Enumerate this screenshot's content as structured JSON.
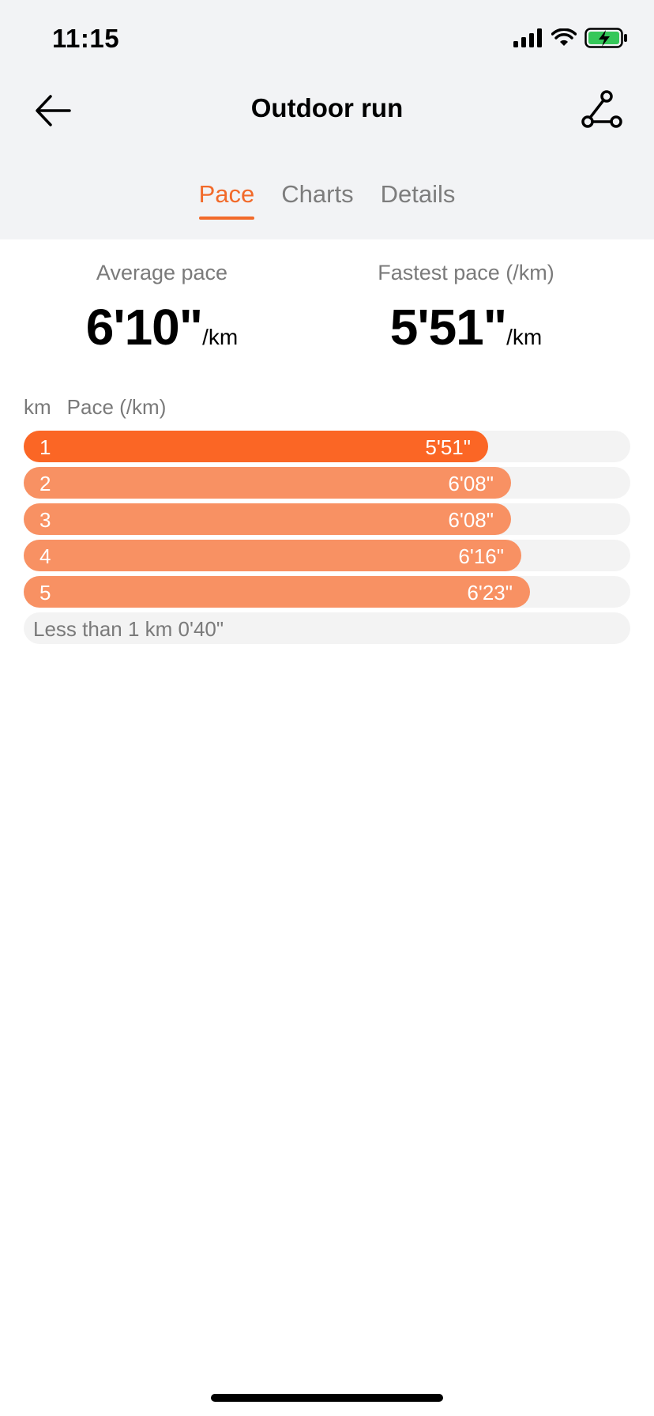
{
  "status_bar": {
    "time": "11:15"
  },
  "header": {
    "title": "Outdoor run"
  },
  "tabs": [
    {
      "label": "Pace",
      "active": true
    },
    {
      "label": "Charts",
      "active": false
    },
    {
      "label": "Details",
      "active": false
    }
  ],
  "summary": {
    "average": {
      "label": "Average pace",
      "value": "6'10\"",
      "unit": "/km"
    },
    "fastest": {
      "label": "Fastest pace (/km)",
      "value": "5'51\"",
      "unit": "/km"
    }
  },
  "table": {
    "header_km": "km",
    "header_pace": "Pace (/km)",
    "rows": [
      {
        "km": "1",
        "pace": "5'51\"",
        "bar_fraction": 0.765,
        "fastest": true
      },
      {
        "km": "2",
        "pace": "6'08\"",
        "bar_fraction": 0.803,
        "fastest": false
      },
      {
        "km": "3",
        "pace": "6'08\"",
        "bar_fraction": 0.803,
        "fastest": false
      },
      {
        "km": "4",
        "pace": "6'16\"",
        "bar_fraction": 0.82,
        "fastest": false
      },
      {
        "km": "5",
        "pace": "6'23\"",
        "bar_fraction": 0.835,
        "fastest": false
      }
    ],
    "remainder": "Less than 1 km 0'40\""
  },
  "colors": {
    "accent": "#f26a2a",
    "bar_fastest": "#fb6625",
    "bar_normal": "#f89163",
    "track": "#f3f3f3"
  }
}
